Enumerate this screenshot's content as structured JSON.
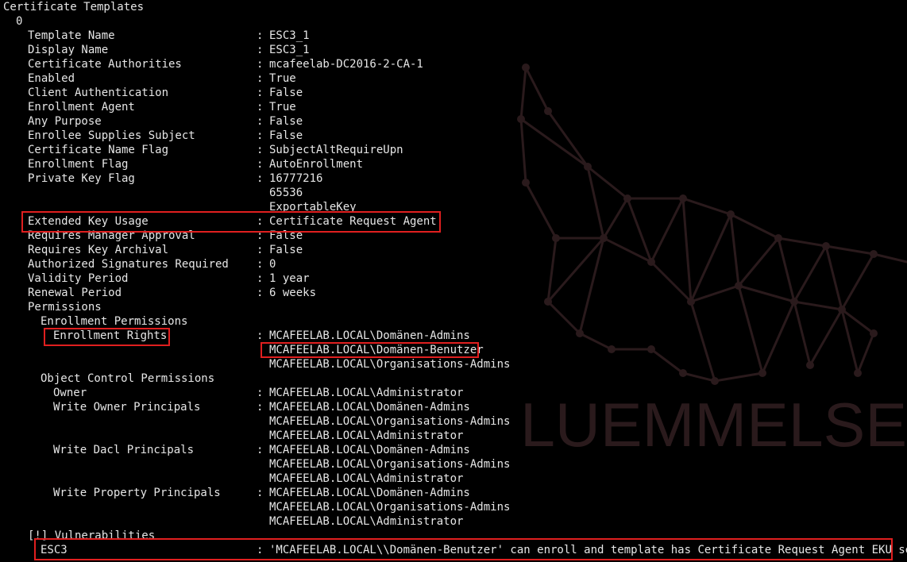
{
  "terminal": {
    "title_line": "Certificate Templates",
    "index": "0",
    "fields": [
      {
        "key": "Template Name",
        "value": "ESC3_1"
      },
      {
        "key": "Display Name",
        "value": "ESC3_1"
      },
      {
        "key": "Certificate Authorities",
        "value": "mcafeelab-DC2016-2-CA-1"
      },
      {
        "key": "Enabled",
        "value": "True"
      },
      {
        "key": "Client Authentication",
        "value": "False"
      },
      {
        "key": "Enrollment Agent",
        "value": "True"
      },
      {
        "key": "Any Purpose",
        "value": "False"
      },
      {
        "key": "Enrollee Supplies Subject",
        "value": "False"
      },
      {
        "key": "Certificate Name Flag",
        "value": "SubjectAltRequireUpn"
      },
      {
        "key": "Enrollment Flag",
        "value": "AutoEnrollment"
      },
      {
        "key": "Private Key Flag",
        "value": "16777216"
      },
      {
        "key": "",
        "value": "65536"
      },
      {
        "key": "",
        "value": "ExportableKey"
      },
      {
        "key": "Extended Key Usage",
        "value": "Certificate Request Agent"
      },
      {
        "key": "Requires Manager Approval",
        "value": "False"
      },
      {
        "key": "Requires Key Archival",
        "value": "False"
      },
      {
        "key": "Authorized Signatures Required",
        "value": "0"
      },
      {
        "key": "Validity Period",
        "value": "1 year"
      },
      {
        "key": "Renewal Period",
        "value": "6 weeks"
      }
    ],
    "permissions_label": "Permissions",
    "enrollment_permissions_label": "Enrollment Permissions",
    "enrollment_rights": {
      "key": "Enrollment Rights",
      "values": [
        "MCAFEELAB.LOCAL\\Domänen-Admins",
        "MCAFEELAB.LOCAL\\Domänen-Benutzer",
        "MCAFEELAB.LOCAL\\Organisations-Admins"
      ]
    },
    "object_control_label": "Object Control Permissions",
    "owner": {
      "key": "Owner",
      "value": "MCAFEELAB.LOCAL\\Administrator"
    },
    "write_owner": {
      "key": "Write Owner Principals",
      "values": [
        "MCAFEELAB.LOCAL\\Domänen-Admins",
        "MCAFEELAB.LOCAL\\Organisations-Admins",
        "MCAFEELAB.LOCAL\\Administrator"
      ]
    },
    "write_dacl": {
      "key": "Write Dacl Principals",
      "values": [
        "MCAFEELAB.LOCAL\\Domänen-Admins",
        "MCAFEELAB.LOCAL\\Organisations-Admins",
        "MCAFEELAB.LOCAL\\Administrator"
      ]
    },
    "write_property": {
      "key": "Write Property Principals",
      "values": [
        "MCAFEELAB.LOCAL\\Domänen-Admins",
        "MCAFEELAB.LOCAL\\Organisations-Admins",
        "MCAFEELAB.LOCAL\\Administrator"
      ]
    },
    "vulnerabilities_label": "[!] Vulnerabilities",
    "vulnerability": {
      "key": "ESC3",
      "value": "'MCAFEELAB.LOCAL\\\\Domänen-Benutzer' can enroll and template has Certificate Request Agent EKU set"
    },
    "separator": ":"
  },
  "watermark": {
    "text": "LUEMMELSE",
    "icon": "wolf-mesh-logo",
    "color": "#2a1a1c"
  },
  "colors": {
    "background": "#000000",
    "text": "#e6e6e6",
    "highlight": "#e01f1f"
  }
}
